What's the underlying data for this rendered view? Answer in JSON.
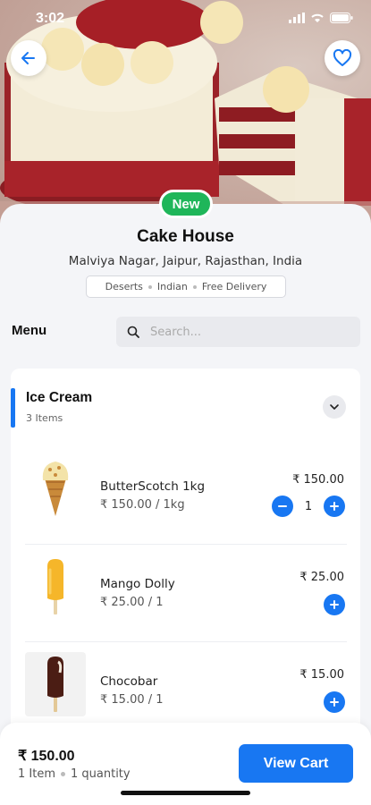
{
  "status_bar": {
    "time": "3:02"
  },
  "icons": {
    "back": "arrow-left-icon",
    "favorite": "heart-icon",
    "search": "search-icon",
    "collapse": "chevron-down-icon",
    "add": "plus-icon",
    "remove": "minus-icon"
  },
  "colors": {
    "accent": "#1877f2",
    "badge": "#1fb65a"
  },
  "shop": {
    "badge": "New",
    "name": "Cake House",
    "address": "Malviya Nagar, Jaipur, Rajasthan, India",
    "tags": [
      "Deserts",
      "Indian",
      "Free Delivery"
    ]
  },
  "menu": {
    "label": "Menu",
    "search_placeholder": "Search..."
  },
  "category": {
    "title": "Ice Cream",
    "count": "3 Items",
    "items": [
      {
        "name": "ButterScotch 1kg",
        "unit_price": "₹ 150.00 / 1kg",
        "price": "₹ 150.00",
        "quantity": "1"
      },
      {
        "name": "Mango Dolly",
        "unit_price": "₹ 25.00 / 1",
        "price": "₹ 25.00"
      },
      {
        "name": "Chocobar",
        "unit_price": "₹ 15.00 / 1",
        "price": "₹ 15.00"
      }
    ]
  },
  "cart": {
    "total": "₹ 150.00",
    "items": "1 Item",
    "quantity": "1 quantity",
    "button": "View Cart"
  }
}
